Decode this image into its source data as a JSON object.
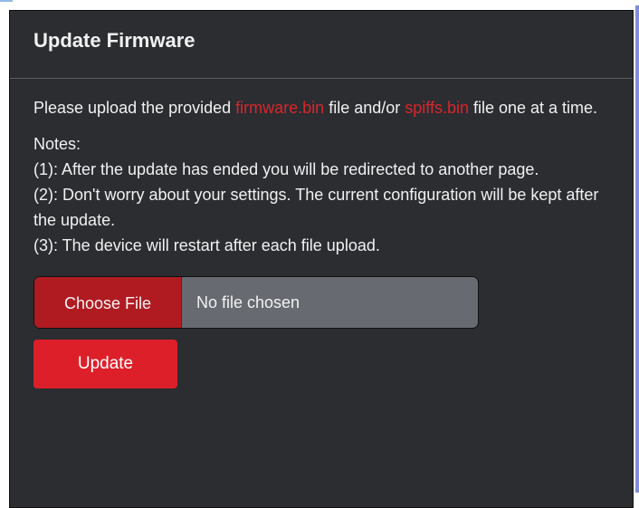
{
  "header": {
    "title": "Update Firmware"
  },
  "intro": {
    "prefix": "Please upload the provided ",
    "firmware_file": "firmware.bin",
    "middle": " file and/or ",
    "spiffs_file": "spiffs.bin",
    "suffix": " file one at a time."
  },
  "notes": {
    "heading": "Notes:",
    "items": [
      "(1): After the update has ended you will be redirected to another page.",
      "(2): Don't worry about your settings. The current configuration will be kept after the update.",
      "(3): The device will restart after each file upload."
    ]
  },
  "file_input": {
    "button_label": "Choose File",
    "status": "No file chosen"
  },
  "actions": {
    "update_label": "Update"
  },
  "colors": {
    "panel_background": "#2b2d31",
    "accent_red": "#d8262b",
    "button_red": "#dd1f2a",
    "dark_red": "#b01b22",
    "text": "#f1f1f1",
    "file_field": "#676a70"
  }
}
